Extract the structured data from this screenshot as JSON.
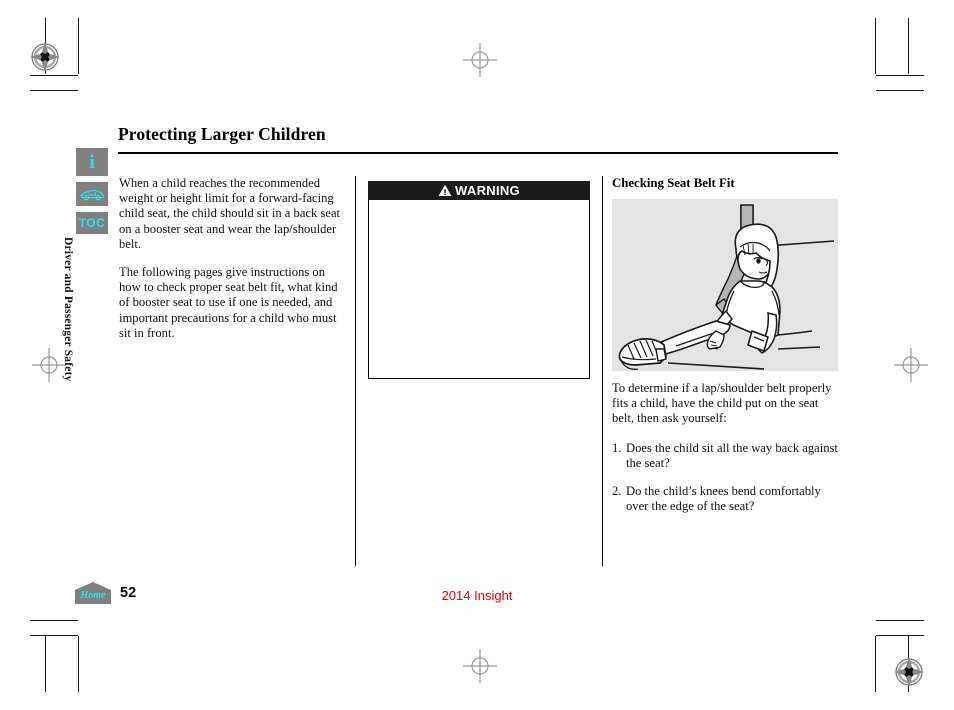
{
  "document": {
    "title": "Protecting Larger Children",
    "page_number": "52",
    "footer_model": "2014 Insight"
  },
  "sidebar": {
    "buttons": [
      {
        "name": "info-button",
        "glyph": "i",
        "label": "i"
      },
      {
        "name": "car-button",
        "glyph": "car-icon",
        "label": ""
      },
      {
        "name": "toc-button",
        "glyph": "TOC",
        "label": "TOC"
      }
    ],
    "section_label": "Driver and Passenger Safety",
    "home_button_label": "Home",
    "button_bg": "#808080",
    "glyph_color": "#22e6ee"
  },
  "col1": {
    "paragraphs": [
      "When a child reaches the recommended weight or height limit for a forward-facing child seat, the child should sit in a back seat on a booster seat and wear the lap/shoulder belt.",
      "The following pages give instructions on how to check proper seat belt fit, what kind of booster seat to use if one is needed, and important precautions for a child who must sit in front."
    ]
  },
  "col2": {
    "warning_label": "WARNING",
    "warning_body": "",
    "header_bg": "#1c1c1c"
  },
  "col3": {
    "heading": "Checking Seat Belt Fit",
    "illustration_name": "child-seated-with-lap-shoulder-belt-illustration",
    "illustration_bg": "#e4e4e4",
    "intro": "To determine if a lap/shoulder belt properly fits a child, have the child put on the seat belt, then ask yourself:",
    "questions": [
      {
        "num": "1.",
        "text": "Does the child sit all the way back against the seat?"
      },
      {
        "num": "2.",
        "text": "Do the child’s knees bend comfortably over the edge of the seat?"
      }
    ]
  },
  "colors": {
    "accent_cyan": "#22e6ee",
    "footer_red": "#ee0000",
    "rule_black": "#000000"
  }
}
